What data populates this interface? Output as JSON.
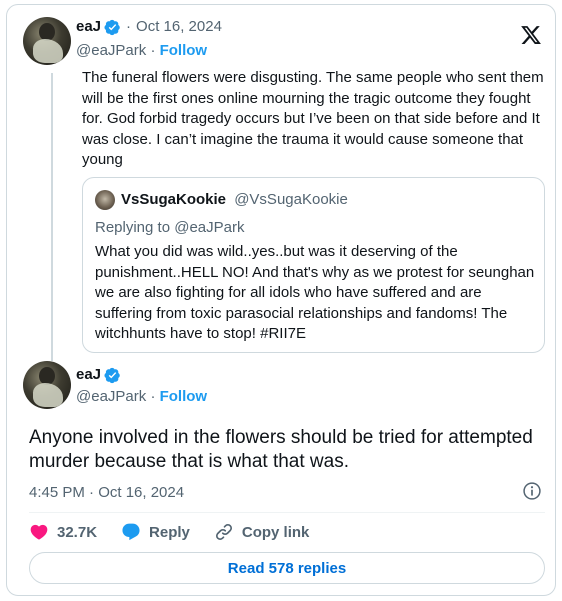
{
  "parent_tweet": {
    "display_name": "eaJ",
    "separator": "·",
    "date": "Oct 16, 2024",
    "handle": "@eaJPark",
    "follow_label": "Follow",
    "text": "The funeral flowers were disgusting. The same people who sent them will be the first ones online mourning the tragic outcome they fought for. God forbid tragedy occurs but I’ve been on that side before and It was close. I can’t imagine the trauma it would cause someone that young"
  },
  "quoted_tweet": {
    "display_name": "VsSugaKookie",
    "handle": "@VsSugaKookie",
    "replying_prefix": "Replying to",
    "replying_to": "@eaJPark",
    "text": "What you did was wild..yes..but was it deserving of the punishment..HELL NO! And that's why as we protest for seunghan we are also fighting for all idols who have suffered and are suffering from toxic parasocial relationships and fandoms! The witchhunts have to stop! #RII7E"
  },
  "main_tweet": {
    "display_name": "eaJ",
    "handle": "@eaJPark",
    "separator": "·",
    "follow_label": "Follow",
    "text": "Anyone involved in the flowers should be tried for attempted murder because that is what that was.",
    "timestamp": "4:45 PM · Oct 16, 2024"
  },
  "actions": {
    "like_count": "32.7K",
    "reply_label": "Reply",
    "copy_link_label": "Copy link"
  },
  "read_replies_label": "Read 578 replies",
  "icons": {
    "verified": "verified-badge-icon",
    "x_logo": "x-logo-icon",
    "info": "info-icon",
    "like": "heart-icon",
    "reply": "speech-bubble-icon",
    "link": "link-icon"
  },
  "colors": {
    "accent": "#1d9bf0",
    "like": "#f91880",
    "text": "#0f1419",
    "secondary": "#536471",
    "border": "#cfd9de",
    "link": "#006fd6"
  }
}
